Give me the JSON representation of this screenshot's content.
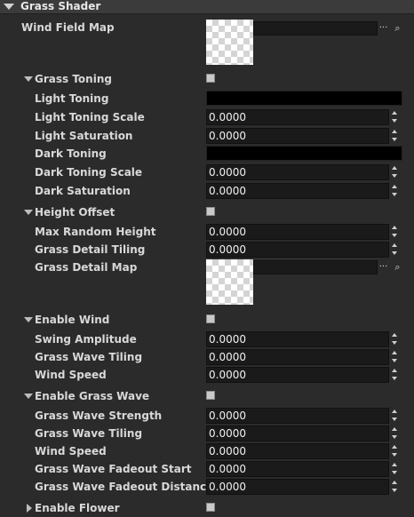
{
  "header": {
    "title": "Grass Shader"
  },
  "wind_field_map": {
    "label": "Wind Field Map",
    "path": ""
  },
  "grass_toning": {
    "label": "Grass Toning",
    "checked": false,
    "light_toning_label": "Light Toning",
    "light_toning_scale": {
      "label": "Light Toning Scale",
      "value": "0.0000"
    },
    "light_saturation": {
      "label": "Light Saturation",
      "value": "0.0000"
    },
    "dark_toning_label": "Dark Toning",
    "dark_toning_scale": {
      "label": "Dark Toning Scale",
      "value": "0.0000"
    },
    "dark_saturation": {
      "label": "Dark Saturation",
      "value": "0.0000"
    },
    "light_color": "#000000",
    "dark_color": "#000000"
  },
  "height_offset": {
    "label": "Height Offset",
    "checked": false,
    "max_random_height": {
      "label": "Max Random Height",
      "value": "0.0000"
    },
    "grass_detail_tiling": {
      "label": "Grass Detail Tiling",
      "value": "0.0000"
    },
    "grass_detail_map": {
      "label": "Grass Detail Map",
      "path": ""
    }
  },
  "enable_wind": {
    "label": "Enable Wind",
    "checked": false,
    "swing_amplitude": {
      "label": "Swing Amplitude",
      "value": "0.0000"
    },
    "grass_wave_tiling": {
      "label": "Grass Wave Tiling",
      "value": "0.0000"
    },
    "wind_speed": {
      "label": "Wind Speed",
      "value": "0.0000"
    }
  },
  "enable_grass_wave": {
    "label": "Enable Grass Wave",
    "checked": false,
    "grass_wave_strength": {
      "label": "Grass Wave Strength",
      "value": "0.0000"
    },
    "grass_wave_tiling": {
      "label": "Grass Wave Tiling",
      "value": "0.0000"
    },
    "wind_speed": {
      "label": "Wind Speed",
      "value": "0.0000"
    },
    "fadeout_start": {
      "label": "Grass Wave Fadeout Start",
      "value": "0.0000"
    },
    "fadeout_distance": {
      "label": "Grass Wave Fadeout Distance",
      "value": "0.0000"
    }
  },
  "enable_flower": {
    "label": "Enable Flower",
    "checked": false
  },
  "icons": {
    "browse": "browse-icon",
    "search": "search-icon",
    "expand": "chevron-down-icon",
    "collapsed": "chevron-right-icon"
  }
}
